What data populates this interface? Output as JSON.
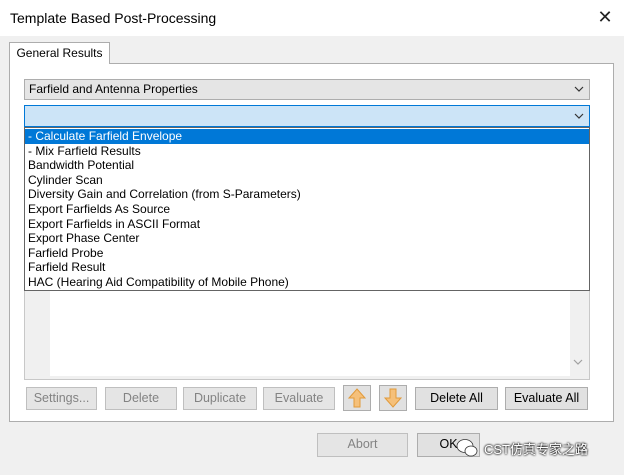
{
  "window": {
    "title": "Template Based Post-Processing"
  },
  "tabs": [
    {
      "label": "General Results"
    }
  ],
  "category_select": {
    "value": "Farfield and Antenna Properties"
  },
  "template_select": {
    "value": "",
    "options": [
      "- Calculate Farfield Envelope",
      "- Mix Farfield Results",
      "Bandwidth Potential",
      "Cylinder Scan",
      "Diversity Gain and Correlation (from S-Parameters)",
      "Export Farfields As Source",
      "Export Farfields in ASCII Format",
      "Export Phase Center",
      "Farfield Probe",
      "Farfield Result",
      "HAC (Hearing Aid Compatibility of Mobile Phone)"
    ],
    "highlighted_index": 0
  },
  "buttons": {
    "settings": "Settings...",
    "delete": "Delete",
    "duplicate": "Duplicate",
    "evaluate": "Evaluate",
    "delete_all": "Delete All",
    "evaluate_all": "Evaluate All",
    "abort": "Abort",
    "ok": "OK"
  },
  "watermark": {
    "text": "CST仿真专家之路"
  },
  "colors": {
    "selection": "#0078d7",
    "combo_focus": "#cce4f7",
    "arrow_orange": "#f5a623"
  },
  "icons": {
    "close": "close-icon",
    "chevron": "chevron-down-icon",
    "move_up": "arrow-up-icon",
    "move_down": "arrow-down-icon"
  }
}
